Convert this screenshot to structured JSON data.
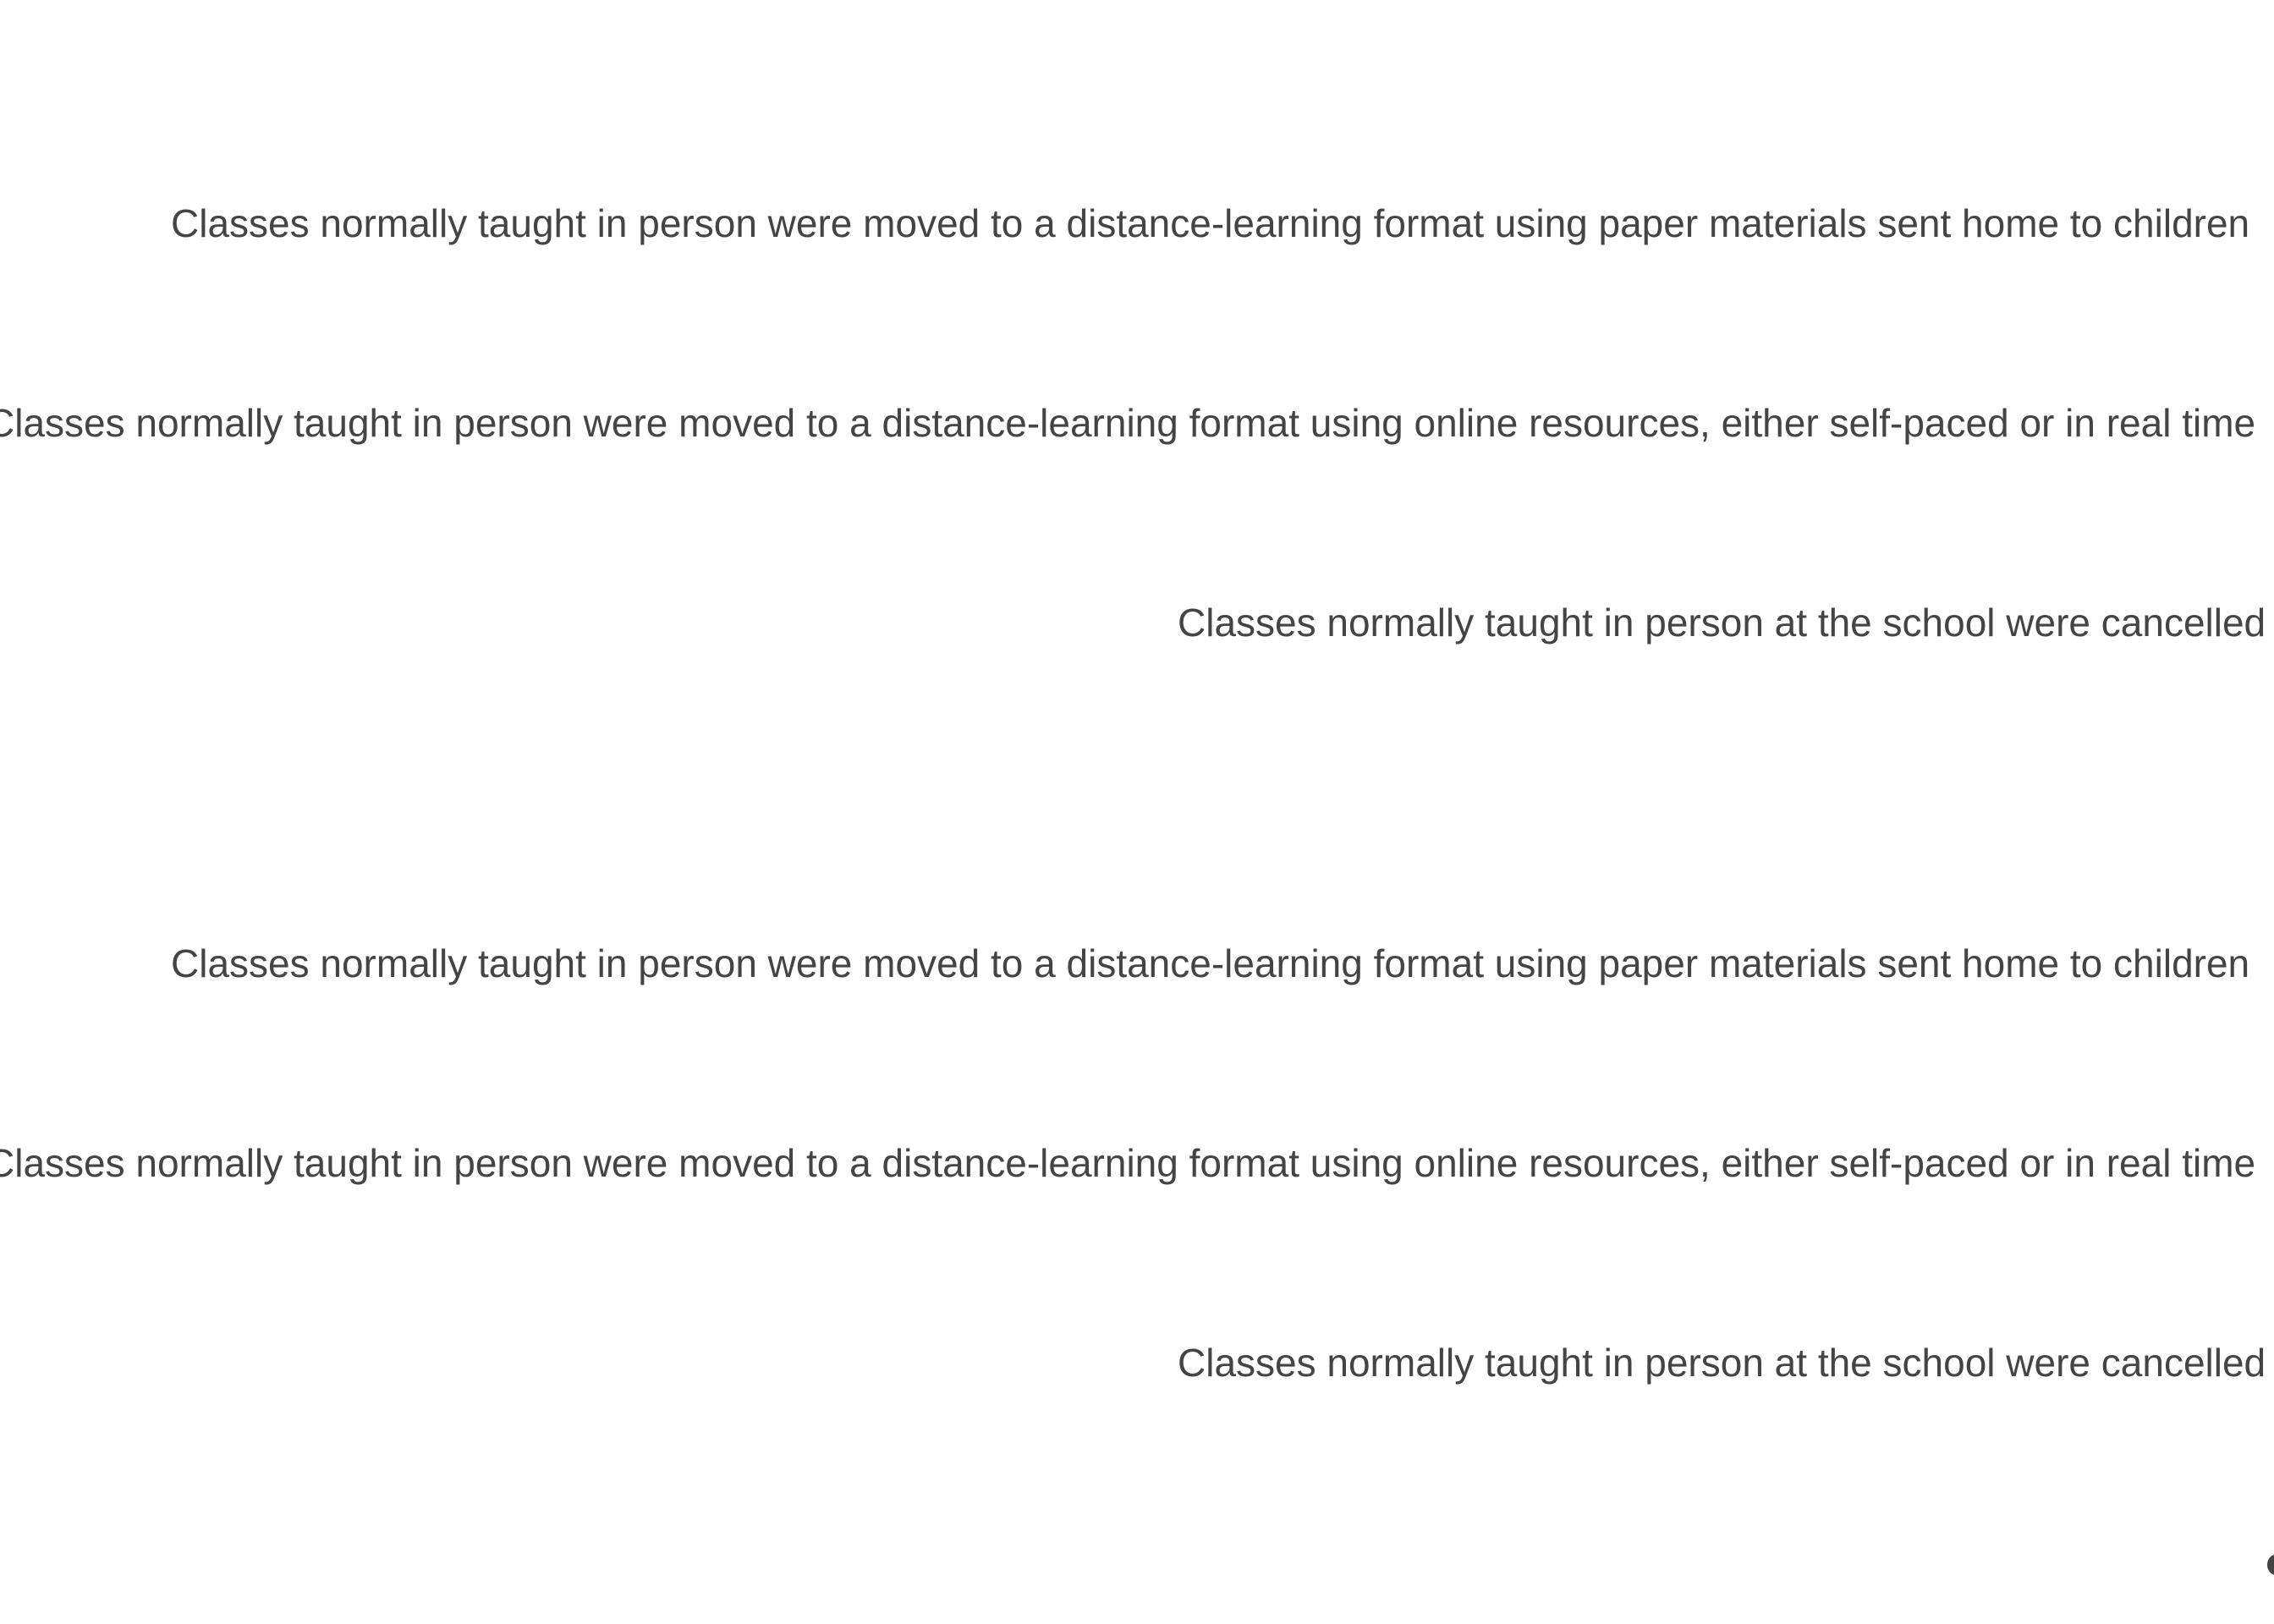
{
  "groups": [
    {
      "options": [
        {
          "label": "Classes normally taught in person were moved to a distance-learning format using paper materials sent home to children"
        },
        {
          "label": "Classes normally taught in person were moved to a distance-learning format using online resources, either self-paced or in real time"
        },
        {
          "label": "Classes normally taught in person at the school were cancelled"
        }
      ]
    },
    {
      "options": [
        {
          "label": "Classes normally taught in person were moved to a distance-learning format using paper materials sent home to children"
        },
        {
          "label": "Classes normally taught in person were moved to a distance-learning format using online resources, either self-paced or in real time"
        },
        {
          "label": "Classes normally taught in person at the school were cancelled"
        }
      ]
    }
  ],
  "colors": {
    "text": "#444444",
    "background": "#ffffff"
  }
}
